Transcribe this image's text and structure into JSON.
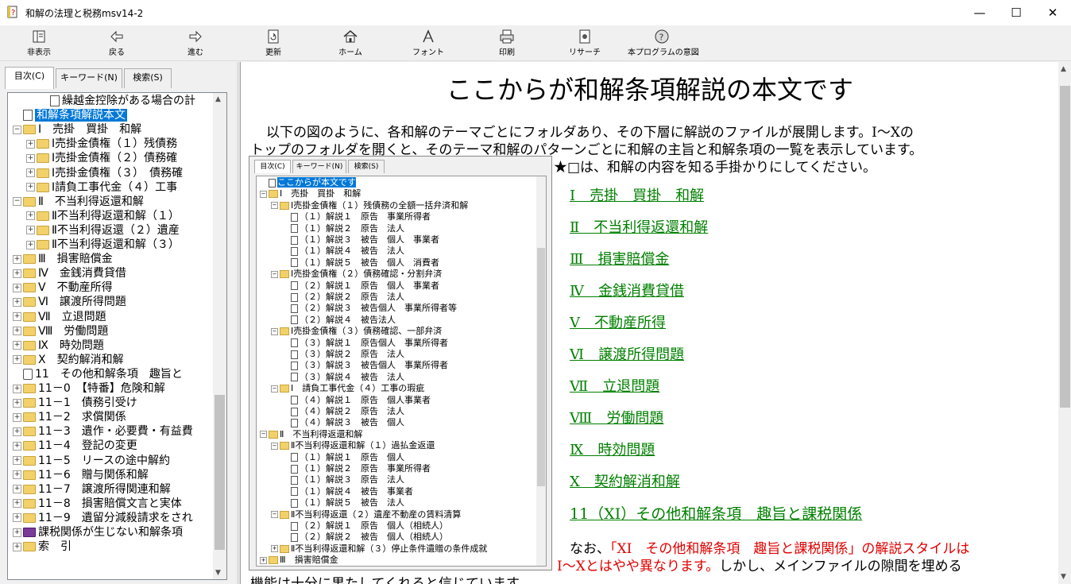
{
  "window": {
    "title": "和解の法理と税務msv14-2",
    "min": "—",
    "max": "☐",
    "close": "✕"
  },
  "toolbar": [
    {
      "name": "hide",
      "label": "非表示"
    },
    {
      "name": "back",
      "label": "戻る"
    },
    {
      "name": "forward",
      "label": "進む"
    },
    {
      "name": "refresh",
      "label": "更新"
    },
    {
      "name": "home",
      "label": "ホーム"
    },
    {
      "name": "font",
      "label": "フォント"
    },
    {
      "name": "print",
      "label": "印刷"
    },
    {
      "name": "research",
      "label": "リサーチ"
    },
    {
      "name": "purpose",
      "label": "本プログラムの意図"
    }
  ],
  "left_tabs": [
    "目次(C)",
    "キーワード(N)",
    "検索(S)"
  ],
  "tree": [
    {
      "text": "繰越金控除がある場合の計",
      "level": 2,
      "kind": "doc"
    },
    {
      "text": "和解条項解説本文",
      "level": 0,
      "kind": "doc",
      "selected": true
    },
    {
      "text": "Ⅰ　売掛　買掛　和解",
      "level": 0,
      "kind": "folder",
      "exp": "-"
    },
    {
      "text": "Ⅰ売掛金債権（１）残債務",
      "level": 1,
      "kind": "folder",
      "exp": "+"
    },
    {
      "text": "Ⅰ売掛金債権（２）債務確",
      "level": 1,
      "kind": "folder",
      "exp": "+"
    },
    {
      "text": "Ⅰ売掛金債権（３）　債務確",
      "level": 1,
      "kind": "folder",
      "exp": "+"
    },
    {
      "text": "Ⅰ請負工事代金（４）工事",
      "level": 1,
      "kind": "folder",
      "exp": "+"
    },
    {
      "text": "Ⅱ　不当利得返還和解",
      "level": 0,
      "kind": "folder",
      "exp": "-"
    },
    {
      "text": "Ⅱ不当利得返還和解（１）",
      "level": 1,
      "kind": "folder",
      "exp": "+"
    },
    {
      "text": "Ⅱ不当利得返還（２）遺産",
      "level": 1,
      "kind": "folder",
      "exp": "+"
    },
    {
      "text": "Ⅱ不当利得返還和解（３）",
      "level": 1,
      "kind": "folder",
      "exp": "+"
    },
    {
      "text": "Ⅲ　損害賠償金",
      "level": 0,
      "kind": "folder",
      "exp": "+"
    },
    {
      "text": "Ⅳ　金銭消費貸借",
      "level": 0,
      "kind": "folder",
      "exp": "+"
    },
    {
      "text": "Ⅴ　不動産所得",
      "level": 0,
      "kind": "folder",
      "exp": "+"
    },
    {
      "text": "Ⅵ　譲渡所得問題",
      "level": 0,
      "kind": "folder",
      "exp": "+"
    },
    {
      "text": "Ⅶ　立退問題",
      "level": 0,
      "kind": "folder",
      "exp": "+"
    },
    {
      "text": "Ⅷ　労働問題",
      "level": 0,
      "kind": "folder",
      "exp": "+"
    },
    {
      "text": "Ⅸ　時効問題",
      "level": 0,
      "kind": "folder",
      "exp": "+"
    },
    {
      "text": "Ⅹ　契約解消和解",
      "level": 0,
      "kind": "folder",
      "exp": "+"
    },
    {
      "text": "11　その他和解条項　趣旨と",
      "level": 0,
      "kind": "book",
      "exp": ""
    },
    {
      "text": "11－0　【特番】危険和解",
      "level": 0,
      "kind": "folder",
      "exp": "+"
    },
    {
      "text": "11－1　債務引受け",
      "level": 0,
      "kind": "folder",
      "exp": "+"
    },
    {
      "text": "11－2　求償関係",
      "level": 0,
      "kind": "folder",
      "exp": "+"
    },
    {
      "text": "11－3　遺作・必要費・有益費",
      "level": 0,
      "kind": "folder",
      "exp": "+"
    },
    {
      "text": "11－4　登記の変更",
      "level": 0,
      "kind": "folder",
      "exp": "+"
    },
    {
      "text": "11－5　リースの途中解約",
      "level": 0,
      "kind": "folder",
      "exp": "+"
    },
    {
      "text": "11－6　贈与関係和解",
      "level": 0,
      "kind": "folder",
      "exp": "+"
    },
    {
      "text": "11－7　譲渡所得関連和解",
      "level": 0,
      "kind": "folder",
      "exp": "+"
    },
    {
      "text": "11－8　損害賠償文言と実体",
      "level": 0,
      "kind": "folder",
      "exp": "+"
    },
    {
      "text": "11－9　遺留分減殺請求をされ",
      "level": 0,
      "kind": "folder",
      "exp": "+"
    },
    {
      "text": "課税関係が生じない和解条項",
      "level": 0,
      "kind": "book2",
      "exp": "+"
    },
    {
      "text": "索　引",
      "level": 0,
      "kind": "folder",
      "exp": "+"
    }
  ],
  "content": {
    "heading": "ここからが和解条項解説の本文です",
    "intro_line1": "以下の図のように、各和解のテーマごとにフォルダあり、その下層に解説のファイルが展開します。Ⅰ～Ⅹの",
    "intro_line2": "トップのフォルダを開くと、そのテーマ和解のパターンごとに和解の主旨と和解条項の一覧を表示しています。",
    "intro_line3": "★□は、和解の内容を知る手掛かりにしてください。",
    "links": [
      "Ⅰ　売掛　買掛　和解",
      "Ⅱ　不当利得返還和解",
      "Ⅲ　損害賠償金",
      "Ⅳ　金銭消費貸借",
      "Ⅴ　不動産所得",
      "Ⅵ　譲渡所得問題",
      "Ⅶ　立退問題",
      "Ⅷ　労働問題",
      "Ⅸ　時効問題",
      "Ⅹ　契約解消和解",
      "11（XI）その他和解条項　趣旨と課税関係"
    ],
    "note_a": "なお、",
    "note_red1": "「XI　その他和解条項　趣旨と課税関係」の解説スタイルは",
    "note_red2": "Ⅰ～Ⅹとはやや異なります。",
    "note_b": "しかし、メインファイルの隙間を埋める",
    "note_c": "機能は十分に果たしてくれると信じています。"
  },
  "mini": {
    "tabs": [
      "目次(C)",
      "キーワード(N)",
      "検索(S)"
    ],
    "nodes": [
      {
        "t": "ここからが本文です",
        "l": 0,
        "k": "doc",
        "sel": true
      },
      {
        "t": "Ⅰ　売掛　買掛　和解",
        "l": 0,
        "k": "folder",
        "e": "-"
      },
      {
        "t": "Ⅰ売掛金債権（１）残債務の全額一括弁済和解",
        "l": 1,
        "k": "folder",
        "e": "-"
      },
      {
        "t": "（１）解説１　原告　事業所得者",
        "l": 2,
        "k": "doc"
      },
      {
        "t": "（１）解説２　原告　法人",
        "l": 2,
        "k": "doc"
      },
      {
        "t": "（１）解説３　被告　個人　事業者",
        "l": 2,
        "k": "doc"
      },
      {
        "t": "（１）解説４　被告　法人",
        "l": 2,
        "k": "doc"
      },
      {
        "t": "（１）解説５　被告　個人　消費者",
        "l": 2,
        "k": "doc"
      },
      {
        "t": "Ⅰ売掛金債権（２）債務確認・分割弁済",
        "l": 1,
        "k": "folder",
        "e": "-"
      },
      {
        "t": "（２）解説１　原告　個人　事業者",
        "l": 2,
        "k": "doc"
      },
      {
        "t": "（２）解説２　原告　法人",
        "l": 2,
        "k": "doc"
      },
      {
        "t": "（２）解説３　被告個人　事業所得者等",
        "l": 2,
        "k": "doc"
      },
      {
        "t": "（２）解説４　被告法人",
        "l": 2,
        "k": "doc"
      },
      {
        "t": "Ⅰ売掛金債権（３）債務確認、一部弁済",
        "l": 1,
        "k": "folder",
        "e": "-"
      },
      {
        "t": "（３）解説１　原告個人　事業所得者",
        "l": 2,
        "k": "doc"
      },
      {
        "t": "（３）解説２　原告　法人",
        "l": 2,
        "k": "doc"
      },
      {
        "t": "（３）解説３　被告個人　事業所得者",
        "l": 2,
        "k": "doc"
      },
      {
        "t": "（３）解説４　被告　法人",
        "l": 2,
        "k": "doc"
      },
      {
        "t": "Ⅰ　請負工事代金（４）工事の瑕疵",
        "l": 1,
        "k": "folder",
        "e": "-"
      },
      {
        "t": "（４）解説１　原告　個人事業者",
        "l": 2,
        "k": "doc"
      },
      {
        "t": "（４）解説２　原告　法人",
        "l": 2,
        "k": "doc"
      },
      {
        "t": "（４）解説３　被告　個人",
        "l": 2,
        "k": "doc"
      },
      {
        "t": "Ⅱ　不当利得返還和解",
        "l": 0,
        "k": "folder",
        "e": "-"
      },
      {
        "t": "Ⅱ不当利得返還和解（１）過払金返還",
        "l": 1,
        "k": "folder",
        "e": "-"
      },
      {
        "t": "（１）解説１　原告　個人",
        "l": 2,
        "k": "doc"
      },
      {
        "t": "（１）解説２　原告　事業所得者",
        "l": 2,
        "k": "doc"
      },
      {
        "t": "（１）解説３　原告　法人",
        "l": 2,
        "k": "doc"
      },
      {
        "t": "（１）解説４　被告　事業者",
        "l": 2,
        "k": "doc"
      },
      {
        "t": "（１）解説５　被告　法人",
        "l": 2,
        "k": "doc"
      },
      {
        "t": "Ⅱ不当利得返還（２）遺産不動産の賃料清算",
        "l": 1,
        "k": "folder",
        "e": "-"
      },
      {
        "t": "（２）解説１　原告　個人（相続人）",
        "l": 2,
        "k": "doc"
      },
      {
        "t": "（２）解説２　被告　個人（相続人）",
        "l": 2,
        "k": "doc"
      },
      {
        "t": "Ⅱ不当利得返還和解（３）停止条件遺贈の条件成就",
        "l": 1,
        "k": "folder",
        "e": "+"
      },
      {
        "t": "Ⅲ　損害賠償金",
        "l": 0,
        "k": "folder",
        "e": "+"
      }
    ]
  }
}
